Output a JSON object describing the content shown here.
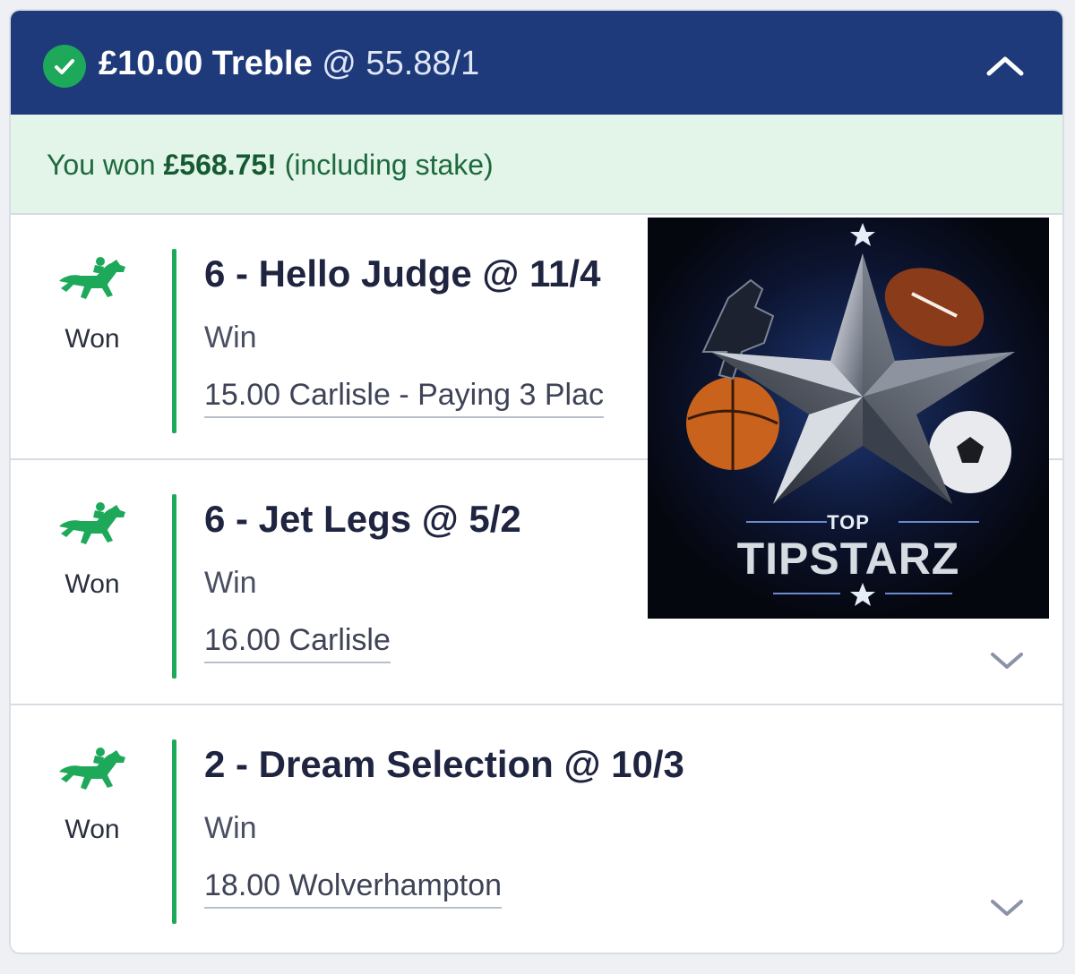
{
  "header": {
    "stake_type": "£10.00 Treble",
    "odds": "@ 55.88/1",
    "status_icon": "check-circle-icon",
    "collapse_icon": "chevron-up-icon"
  },
  "banner": {
    "prefix": "You won ",
    "amount": "£568.75!",
    "suffix": " (including stake)"
  },
  "legs": [
    {
      "title": "6 - Hello Judge @ 11/4",
      "market": "Win",
      "event": "15.00 Carlisle - Paying 3 Plac",
      "result": "Won",
      "icon": "horse-racing-icon"
    },
    {
      "title": "6 - Jet Legs @ 5/2",
      "market": "Win",
      "event": "16.00 Carlisle",
      "result": "Won",
      "icon": "horse-racing-icon"
    },
    {
      "title": "2 - Dream Selection @ 10/3",
      "market": "Win",
      "event": "18.00 Wolverhampton",
      "result": "Won",
      "icon": "horse-racing-icon"
    }
  ],
  "promo": {
    "top": "TOP",
    "name": "TIPSTARZ"
  },
  "colors": {
    "header_bg": "#1e3a7b",
    "win_green": "#1ea95a",
    "banner_bg": "#e3f4e9",
    "banner_text": "#1d6a3c"
  }
}
